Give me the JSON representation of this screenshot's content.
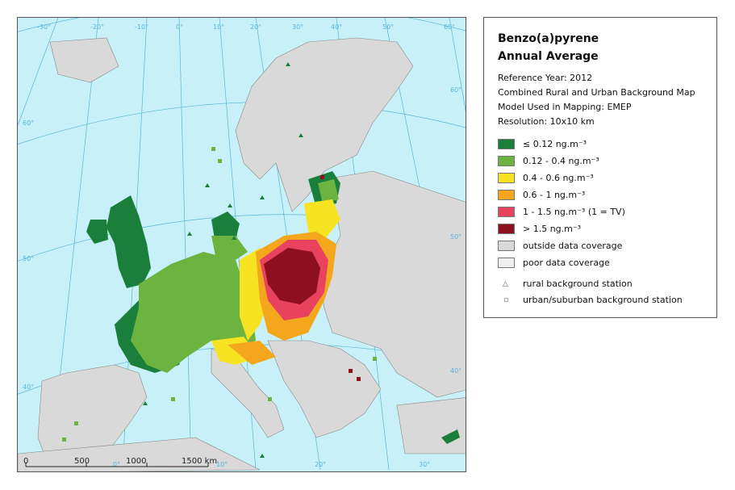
{
  "legend": {
    "title_line1": "Benzo(a)pyrene",
    "title_line2": "Annual Average",
    "reference_year": "Reference Year: 2012",
    "map_type": "Combined Rural and Urban Background Map",
    "model": "Model Used in Mapping: EMEP",
    "resolution": "Resolution: 10x10 km",
    "classes": [
      {
        "label": "≤ 0.12 ng.m⁻³",
        "color": "#1a7f3a"
      },
      {
        "label": "0.12 - 0.4 ng.m⁻³",
        "color": "#6cb33f"
      },
      {
        "label": "0.4 - 0.6 ng.m⁻³",
        "color": "#f8e323"
      },
      {
        "label": "0.6 - 1 ng.m⁻³",
        "color": "#f4a71d"
      },
      {
        "label": "1 - 1.5 ng.m⁻³  (1 = TV)",
        "color": "#e8425e"
      },
      {
        "label": "> 1.5 ng.m⁻³",
        "color": "#8e1020"
      },
      {
        "label": "outside data coverage",
        "color": "#d9d9d9"
      },
      {
        "label": "poor data coverage",
        "color": "#efefef"
      }
    ],
    "stations": [
      {
        "label": "rural background station",
        "icon": "triangle-icon"
      },
      {
        "label": "urban/suburban background station",
        "icon": "square-icon"
      }
    ]
  },
  "map": {
    "colors": {
      "sea": "#c8f0f8",
      "land_out": "#d9d9d9",
      "grid": "#57b6d6"
    },
    "graticule_labels": {
      "top": [
        "-30°",
        "-20°",
        "-10°",
        "0°",
        "10°",
        "20°",
        "30°",
        "40°",
        "50°",
        "60°"
      ],
      "right": [
        "60°",
        "50°",
        "40°"
      ],
      "left": [
        "60°",
        "50°",
        "40°"
      ],
      "bottom": [
        "0°",
        "10°",
        "20°",
        "30°"
      ]
    },
    "scale": {
      "ticks": [
        "0",
        "500",
        "1000",
        "1500 km"
      ]
    }
  }
}
